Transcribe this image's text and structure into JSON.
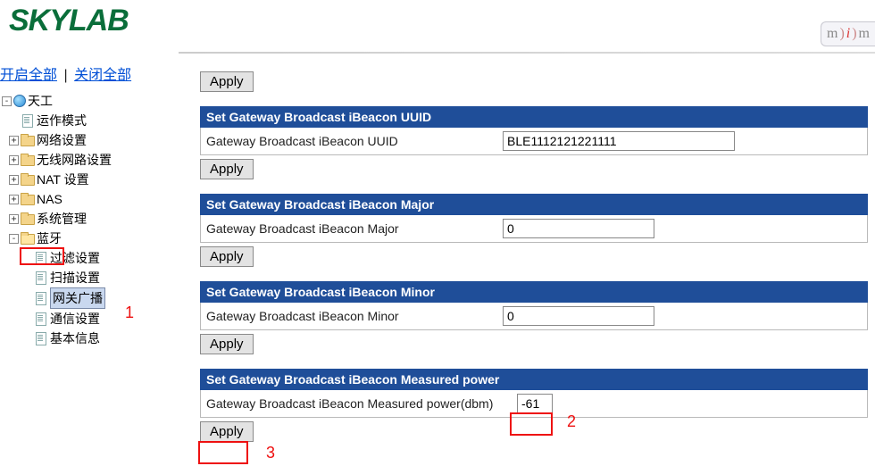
{
  "brand": "SKYLAB",
  "badge": {
    "m": "m",
    "paren": ")",
    "i": "i"
  },
  "open_all_label": "开启全部",
  "close_all_label": "关闭全部",
  "tree": {
    "root_label": "天工",
    "items": [
      {
        "label": "运作模式",
        "kind": "page",
        "toggle": "none"
      },
      {
        "label": "网络设置",
        "kind": "folder",
        "toggle": "plus"
      },
      {
        "label": "无线网路设置",
        "kind": "folder",
        "toggle": "plus"
      },
      {
        "label": "NAT 设置",
        "kind": "folder",
        "toggle": "plus"
      },
      {
        "label": "NAS",
        "kind": "folder",
        "toggle": "plus"
      },
      {
        "label": "系统管理",
        "kind": "folder",
        "toggle": "plus"
      },
      {
        "label": "蓝牙",
        "kind": "folder",
        "toggle": "minus",
        "open": true,
        "children": [
          {
            "label": "过滤设置"
          },
          {
            "label": "扫描设置"
          },
          {
            "label": "网关广播",
            "selected": true
          },
          {
            "label": "通信设置"
          },
          {
            "label": "基本信息"
          }
        ]
      }
    ]
  },
  "apply_label": "Apply",
  "sections": {
    "uuid": {
      "header": "Set Gateway Broadcast iBeacon UUID",
      "label": "Gateway Broadcast iBeacon UUID",
      "value": "BLE1112121221111"
    },
    "major": {
      "header": "Set Gateway Broadcast iBeacon Major",
      "label": "Gateway Broadcast iBeacon Major",
      "value": "0"
    },
    "minor": {
      "header": "Set Gateway Broadcast iBeacon Minor",
      "label": "Gateway Broadcast iBeacon Minor",
      "value": "0"
    },
    "power": {
      "header": "Set Gateway Broadcast iBeacon Measured power",
      "label": "Gateway Broadcast iBeacon Measured power(dbm)",
      "value": "-61"
    }
  },
  "annotations": {
    "n1": "1",
    "n2": "2",
    "n3": "3"
  }
}
